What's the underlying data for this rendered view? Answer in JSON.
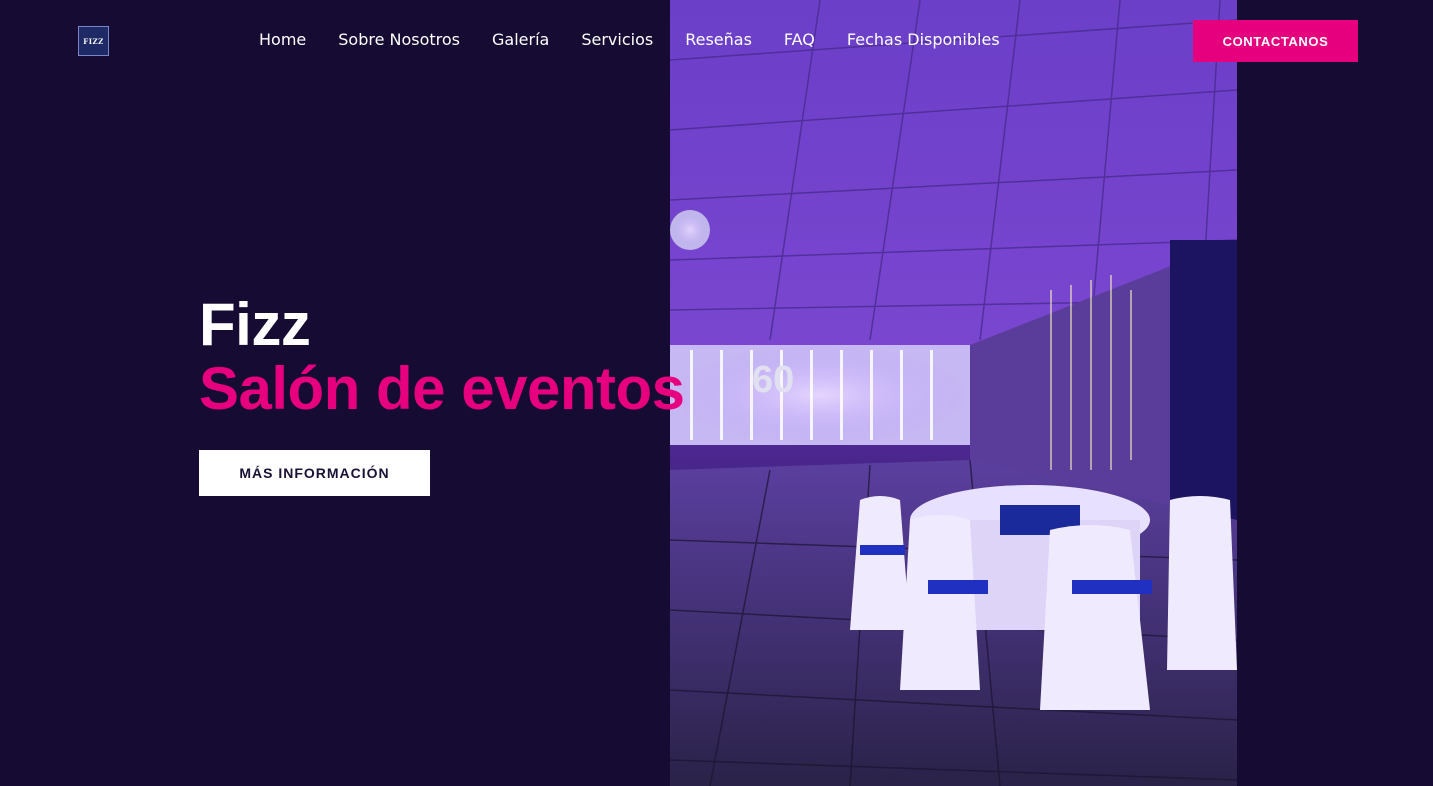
{
  "brand": {
    "logo_text": "FIZZ"
  },
  "nav": {
    "items": [
      "Home",
      "Sobre Nosotros",
      "Galería",
      "Servicios",
      "Reseñas",
      "FAQ",
      "Fechas Disponibles"
    ]
  },
  "header": {
    "cta_label": "CONTACTANOS"
  },
  "hero": {
    "title": "Fizz",
    "subtitle": "Salón de eventos",
    "button_label": "MÁS INFORMACIÓN",
    "photo_banner": "60"
  },
  "colors": {
    "background": "#150b33",
    "accent": "#e6007e",
    "button_bg": "#ffffff"
  }
}
